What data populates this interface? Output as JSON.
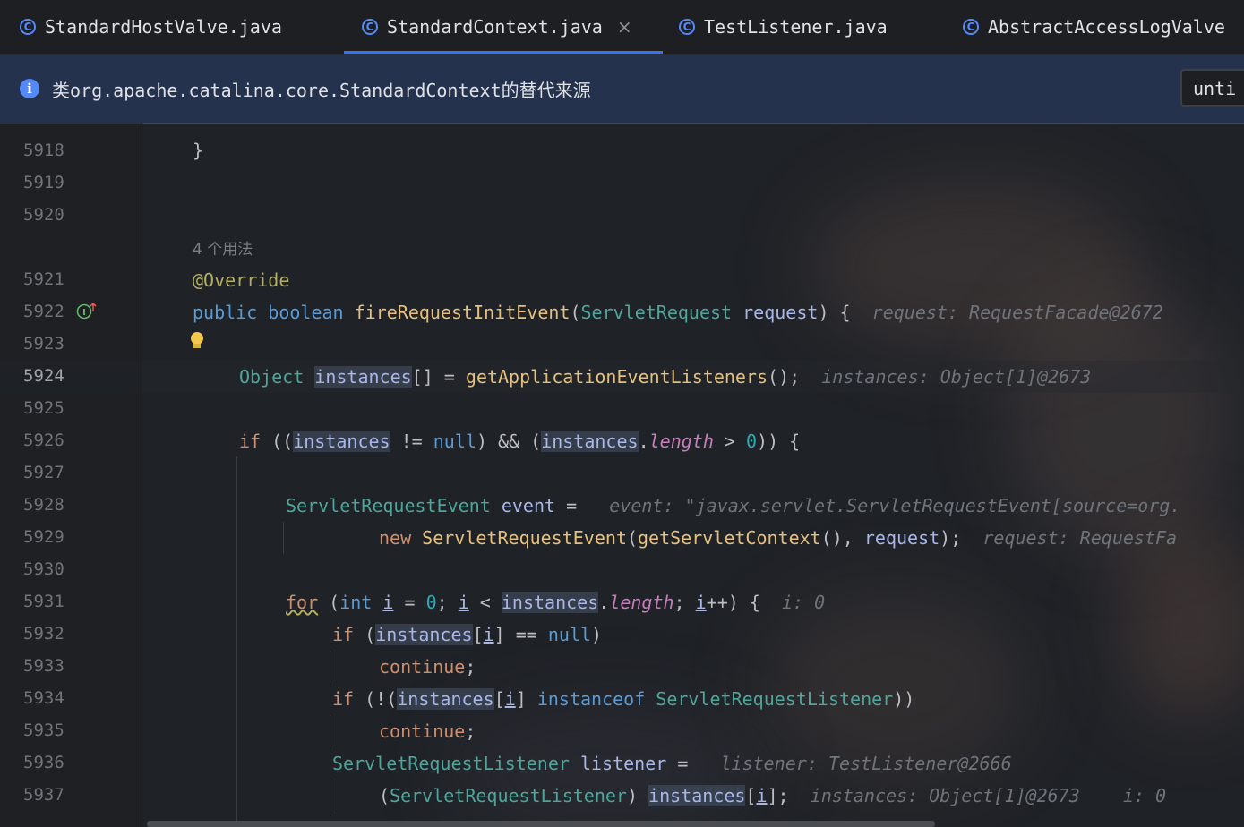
{
  "tabs": [
    {
      "label": "StandardHostValve.java",
      "active": false
    },
    {
      "label": "StandardContext.java",
      "active": true
    },
    {
      "label": "TestListener.java",
      "active": false
    },
    {
      "label": "AbstractAccessLogValve",
      "active": false
    }
  ],
  "tab_close_glyph": "×",
  "banner": {
    "message": "类org.apache.catalina.core.StandardContext的替代来源",
    "selector_value": "unti"
  },
  "line_numbers": [
    "5918",
    "5919",
    "5920",
    "5921",
    "5922",
    "5923",
    "5924",
    "5925",
    "5926",
    "5927",
    "5928",
    "5929",
    "5930",
    "5931",
    "5932",
    "5933",
    "5934",
    "5935",
    "5936",
    "5937"
  ],
  "usages_hint": "4 个用法",
  "code": {
    "l5918": "}",
    "annotation": "@Override",
    "sig_public": "public",
    "sig_boolean": "boolean",
    "sig_method": "fireRequestInitEvent",
    "sig_type": "ServletRequest",
    "sig_param": "request",
    "sig_hint": "request: RequestFacade@2672",
    "l5924_type": "Object",
    "l5924_var": "instances",
    "l5924_rest": "[] = ",
    "l5924_call": "getApplicationEventListeners",
    "l5924_end": "();",
    "l5924_hint": "instances: Object[1]@2673",
    "if": "if",
    "instances": "instances",
    "null": "null",
    "length": "length",
    "zero": "0",
    "l5928_type": "ServletRequestEvent",
    "l5928_var": "event",
    "l5928_hint": "event: \"javax.servlet.ServletRequestEvent[source=org.",
    "new": "new",
    "l5929_call": "getServletContext",
    "l5929_hint": "request: RequestFa",
    "for": "for",
    "int": "int",
    "i": "i",
    "for_hint": "i: 0",
    "continue": "continue",
    "instanceof": "instanceof",
    "listener_type": "ServletRequestListener",
    "listener_var": "listener",
    "l5936_hint": "listener: TestListener@2666",
    "l5937_hint1": "instances: Object[1]@2673",
    "l5937_hint2": "i: 0"
  },
  "colors": {
    "accent": "#3574f0",
    "keyword": "#cf8e6d",
    "type": "#4ea59a",
    "function": "#e6c07b"
  }
}
